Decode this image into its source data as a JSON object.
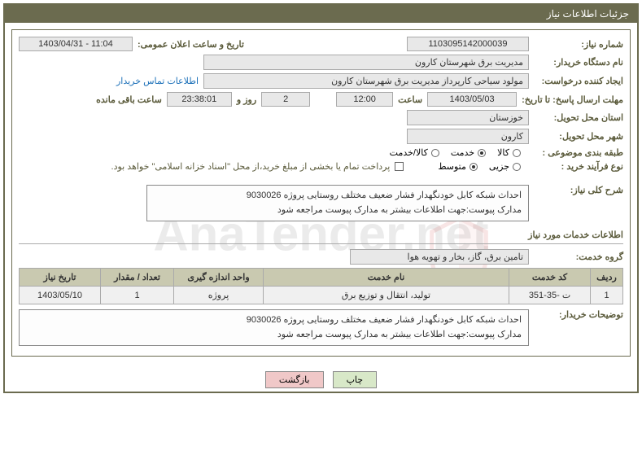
{
  "watermark": "AnaTender.net",
  "title": "جزئیات اطلاعات نیاز",
  "fields": {
    "need_number_label": "شماره نیاز:",
    "need_number": "1103095142000039",
    "announce_label": "تاریخ و ساعت اعلان عمومی:",
    "announce_value": "1403/04/31 - 11:04",
    "buyer_org_label": "نام دستگاه خریدار:",
    "buyer_org": "مدیریت برق شهرستان کارون",
    "requester_label": "ایجاد کننده درخواست:",
    "requester": "مولود سیاحی کارپرداز مدیریت برق شهرستان کارون",
    "contact_link": "اطلاعات تماس خریدار",
    "deadline_label": "مهلت ارسال پاسخ: تا تاریخ:",
    "deadline_date": "1403/05/03",
    "time_label": "ساعت",
    "deadline_time": "12:00",
    "days_count": "2",
    "days_label": "روز و",
    "remaining_time": "23:38:01",
    "remaining_label": "ساعت باقی مانده",
    "delivery_province_label": "استان محل تحویل:",
    "delivery_province": "خوزستان",
    "delivery_city_label": "شهر محل تحویل:",
    "delivery_city": "کارون",
    "category_label": "طبقه بندی موضوعی :",
    "cat_goods": "کالا",
    "cat_service": "خدمت",
    "cat_goods_service": "کالا/خدمت",
    "process_label": "نوع فرآیند خرید :",
    "proc_minor": "جزیی",
    "proc_medium": "متوسط",
    "payment_note": "پرداخت تمام یا بخشی از مبلغ خرید،از محل \"اسناد خزانه اسلامی\" خواهد بود.",
    "general_desc_label": "شرح کلی نیاز:",
    "general_desc": "احداث شبکه کابل خودنگهدار فشار ضعیف مختلف روستایی پروژه 9030026\nمدارک پیوست:جهت اطلاعات بیشتر به مدارک پیوست مراجعه شود",
    "services_section": "اطلاعات خدمات مورد نیاز",
    "service_group_label": "گروه خدمت:",
    "service_group": "تامین برق، گاز، بخار و تهویه هوا",
    "buyer_notes_label": "توضیحات خریدار:",
    "buyer_notes": "احداث شبکه کابل خودنگهدار فشار ضعیف مختلف روستایی پروژه 9030026\nمدارک پیوست:جهت اطلاعات بیشتر به مدارک پیوست مراجعه شود"
  },
  "table": {
    "headers": {
      "row": "ردیف",
      "code": "کد خدمت",
      "name": "نام خدمت",
      "unit": "واحد اندازه گیری",
      "qty": "تعداد / مقدار",
      "date": "تاریخ نیاز"
    },
    "rows": [
      {
        "row": "1",
        "code": "ت -35-351",
        "name": "توليد، انتقال و توزيع برق",
        "unit": "پروژه",
        "qty": "1",
        "date": "1403/05/10"
      }
    ]
  },
  "buttons": {
    "print": "چاپ",
    "back": "بازگشت"
  }
}
